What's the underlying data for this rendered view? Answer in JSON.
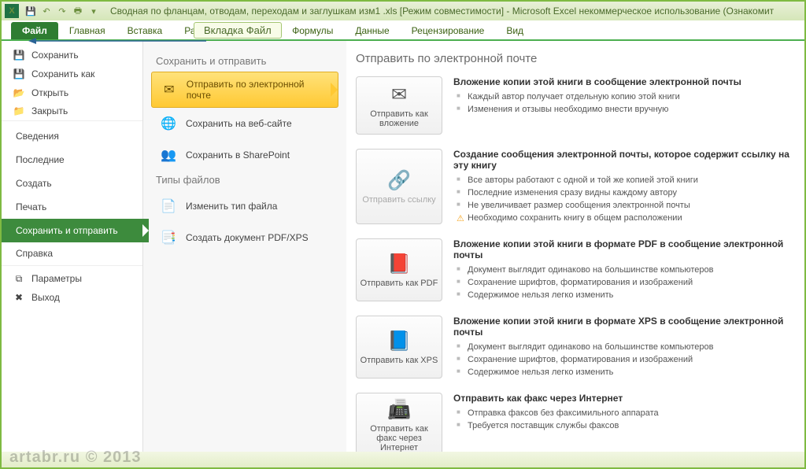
{
  "titlebar": {
    "document": "Сводная по фланцам, отводам, переходам и заглушкам изм1 .xls  [Режим совместимости]  -  Microsoft Excel некоммерческое использование (Ознакомит"
  },
  "ribbon": {
    "tabs": [
      "Файл",
      "Главная",
      "Вставка",
      "Разметка страницы",
      "Формулы",
      "Данные",
      "Рецензирование",
      "Вид"
    ]
  },
  "callout": {
    "label": "Вкладка Файл"
  },
  "left": {
    "items": [
      {
        "label": "Сохранить",
        "icon": "💾"
      },
      {
        "label": "Сохранить как",
        "icon": "💾"
      },
      {
        "label": "Открыть",
        "icon": "📂"
      },
      {
        "label": "Закрыть",
        "icon": "📁"
      },
      {
        "label": "Сведения"
      },
      {
        "label": "Последние"
      },
      {
        "label": "Создать"
      },
      {
        "label": "Печать"
      },
      {
        "label": "Сохранить и отправить"
      },
      {
        "label": "Справка"
      },
      {
        "label": "Параметры",
        "icon": "⧉"
      },
      {
        "label": "Выход",
        "icon": "✖"
      }
    ]
  },
  "mid": {
    "group1_title": "Сохранить и отправить",
    "group1": [
      {
        "label": "Отправить по электронной почте",
        "icon": "✉"
      },
      {
        "label": "Сохранить на веб-сайте",
        "icon": "🌐"
      },
      {
        "label": "Сохранить в SharePoint",
        "icon": "👥"
      }
    ],
    "group2_title": "Типы файлов",
    "group2": [
      {
        "label": "Изменить тип файла",
        "icon": "📄"
      },
      {
        "label": "Создать документ PDF/XPS",
        "icon": "📑"
      }
    ]
  },
  "right": {
    "title": "Отправить по электронной почте",
    "options": [
      {
        "button": "Отправить как вложение",
        "icon": "✉",
        "heading": "Вложение копии этой книги в сообщение электронной почты",
        "bullets": [
          "Каждый автор получает отдельную копию этой книги",
          "Изменения и отзывы необходимо внести вручную"
        ]
      },
      {
        "button": "Отправить ссылку",
        "icon": "🔗",
        "disabled": true,
        "heading": "Создание сообщения электронной почты, которое содержит ссылку на эту книгу",
        "bullets": [
          "Все авторы работают с одной и той же копией этой книги",
          "Последние изменения сразу видны каждому автору",
          "Не увеличивает размер сообщения электронной почты"
        ],
        "warn": "Необходимо сохранить книгу в общем расположении"
      },
      {
        "button": "Отправить как PDF",
        "icon": "📕",
        "heading": "Вложение копии этой книги в формате PDF в сообщение электронной почты",
        "bullets": [
          "Документ выглядит одинаково на большинстве компьютеров",
          "Сохранение шрифтов, форматирования и изображений",
          "Содержимое нельзя легко изменить"
        ]
      },
      {
        "button": "Отправить как XPS",
        "icon": "📘",
        "heading": "Вложение копии этой книги в формате XPS в сообщение электронной почты",
        "bullets": [
          "Документ выглядит одинаково на большинстве компьютеров",
          "Сохранение шрифтов, форматирования и изображений",
          "Содержимое нельзя легко изменить"
        ]
      },
      {
        "button": "Отправить как факс через Интернет",
        "icon": "📠",
        "heading": "Отправить как факс через Интернет",
        "bullets": [
          "Отправка факсов без факсимильного аппарата",
          "Требуется поставщик службы факсов"
        ]
      }
    ]
  },
  "watermark": "artabr.ru © 2013"
}
